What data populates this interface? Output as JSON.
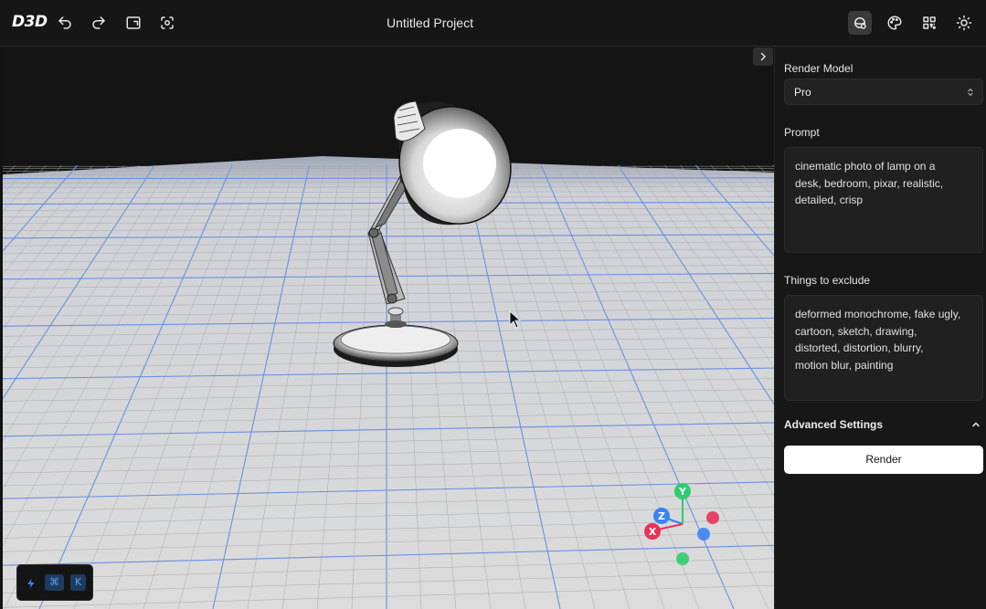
{
  "app": {
    "logo": "D3D",
    "project_title": "Untitled Project"
  },
  "toolbar": {
    "left": [
      "undo-icon",
      "redo-icon",
      "window-icon",
      "scan-icon"
    ],
    "right": [
      "render-view-icon",
      "palette-icon",
      "layout-icon",
      "sun-icon"
    ]
  },
  "panel": {
    "render_model_label": "Render Model",
    "render_model_value": "Pro",
    "prompt_label": "Prompt",
    "prompt_lines": [
      "cinematic photo of lamp on a",
      "desk, bedroom, pixar, realistic,",
      "detailed, crisp"
    ],
    "exclude_label": "Things to exclude",
    "exclude_lines": [
      "deformed monochrome, fake ugly,",
      "cartoon, sketch, drawing,",
      "distorted, distortion, blurry,",
      "motion blur, painting"
    ],
    "advanced_label": "Advanced Settings",
    "render_button": "Render"
  },
  "gizmo": {
    "y_label": "Y",
    "z_label": "Z",
    "x_label": "X",
    "colors": {
      "x": "#e8325a",
      "y": "#2ecc71",
      "z": "#3b82f6"
    }
  },
  "shortcut": {
    "keys": [
      "⌘",
      "K"
    ]
  }
}
